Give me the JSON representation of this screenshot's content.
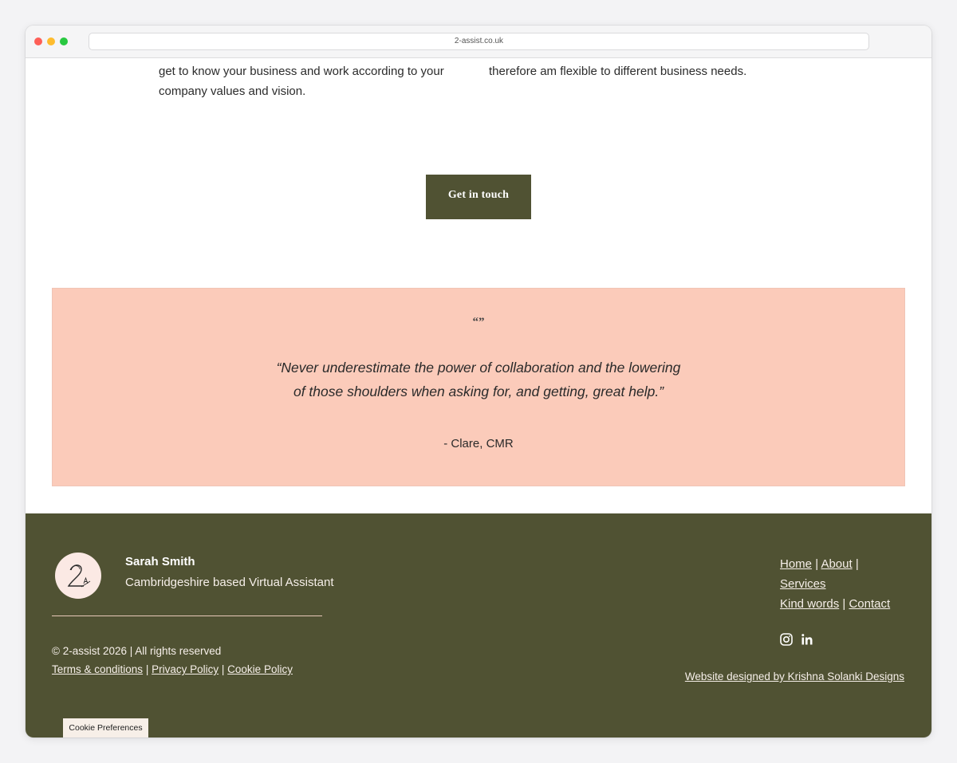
{
  "browser": {
    "url": "2-assist.co.uk"
  },
  "intro": {
    "left_text": "get to know your business and work according to your company values and vision.",
    "right_text": "therefore am flexible to different business needs."
  },
  "cta": {
    "label": "Get in touch"
  },
  "testimonial": {
    "quote_mark": "“”",
    "quote": "“Never underestimate the power of collaboration and the lowering of those shoulders when asking for, and getting, great help.”",
    "author": "- Clare, CMR"
  },
  "footer": {
    "name": "Sarah Smith",
    "tagline": "Cambridgeshire based Virtual Assistant",
    "copyright": "© 2-assist 2026 | All rights reserved",
    "legal": {
      "terms": "Terms & conditions",
      "privacy": "Privacy Policy",
      "cookie": "Cookie Policy",
      "separator": "|"
    },
    "nav": {
      "home": "Home",
      "about": "About",
      "services": "Services",
      "kind_words": "Kind words",
      "contact": "Contact",
      "separator": "|"
    },
    "social": {
      "instagram_icon": "instagram-icon",
      "linkedin_icon": "linkedin-icon"
    },
    "credit": "Website designed by Krishna Solanki Designs"
  },
  "cookie_preferences": {
    "label": "Cookie Preferences"
  },
  "colors": {
    "olive": "#505233",
    "peach": "#fbcbba",
    "footer_text": "#f6efe9"
  }
}
